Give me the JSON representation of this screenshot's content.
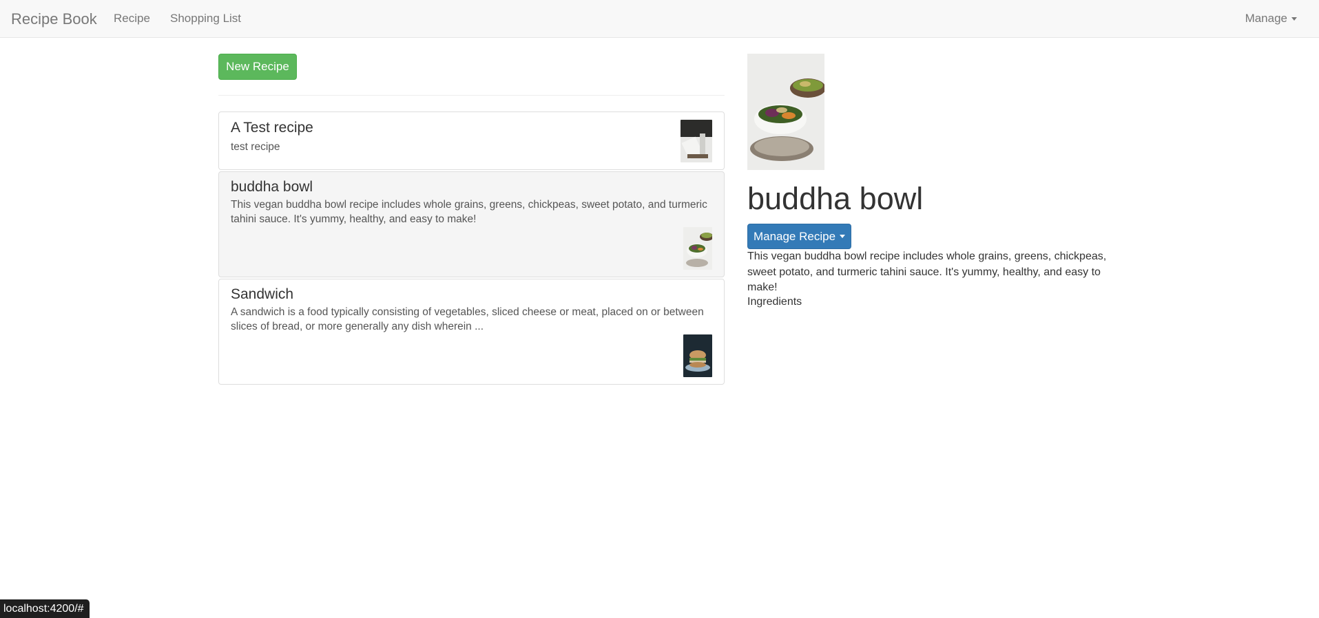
{
  "navbar": {
    "brand": "Recipe Book",
    "links": [
      {
        "label": "Recipe"
      },
      {
        "label": "Shopping List"
      }
    ],
    "manage_label": "Manage"
  },
  "sidebar": {
    "new_button_label": "New Recipe",
    "recipes": [
      {
        "title": "A Test recipe",
        "description": "test recipe",
        "active": false
      },
      {
        "title": "buddha bowl",
        "description": "This vegan buddha bowl recipe includes whole grains, greens, chickpeas, sweet potato, and turmeric tahini sauce. It's yummy, healthy, and easy to make!",
        "active": true
      },
      {
        "title": "Sandwich",
        "description": "A sandwich is a food typically consisting of vegetables, sliced cheese or meat, placed on or between slices of bread, or more generally any dish wherein ...",
        "active": false
      }
    ]
  },
  "detail": {
    "title": "buddha bowl",
    "manage_button_label": "Manage Recipe",
    "description": "This vegan buddha bowl recipe includes whole grains, greens, chickpeas, sweet potato, and turmeric tahini sauce. It's yummy, healthy, and easy to make!",
    "ingredients_label": "Ingredients"
  },
  "status_bar": {
    "url": "localhost:4200/#"
  },
  "colors": {
    "success": "#5cb85c",
    "primary": "#337ab7",
    "navbar_bg": "#f8f8f8"
  }
}
